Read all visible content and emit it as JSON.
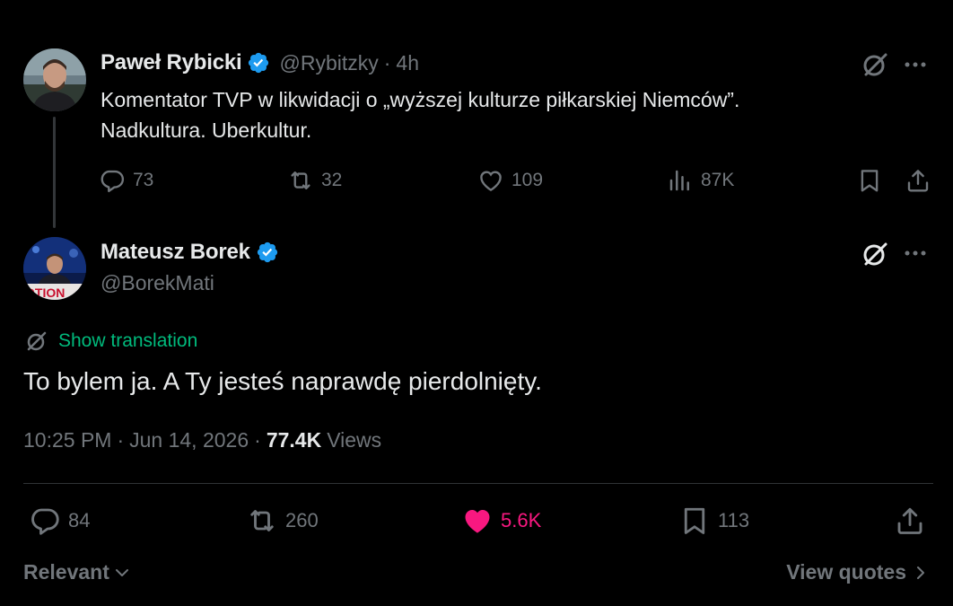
{
  "parent_tweet": {
    "display_name": "Paweł Rybicki",
    "handle": "@Rybitzky",
    "separator": "·",
    "time": "4h",
    "text_line1": "Komentator TVP w likwidacji o „wyższej kulturze piłkarskiej Niemców”.",
    "text_line2": "Nadkultura. Uberkultur.",
    "stats": {
      "replies": "73",
      "reposts": "32",
      "likes": "109",
      "views": "87K"
    }
  },
  "reply_tweet": {
    "display_name": "Mateusz Borek",
    "handle": "@BorekMati",
    "show_translation": "Show translation",
    "text": "To bylem ja. A Ty jesteś naprawdę pierdolnięty.",
    "timestamp": "10:25 PM",
    "date": "Jun 14, 2026",
    "separator": "·",
    "views_count": "77.4K",
    "views_label": "Views",
    "stats": {
      "replies": "84",
      "reposts": "260",
      "likes": "5.6K",
      "bookmarks": "113"
    }
  },
  "footer": {
    "sort_label": "Relevant",
    "view_quotes": "View quotes"
  },
  "colors": {
    "background": "#000000",
    "text_primary": "#e7e9ea",
    "text_secondary": "#71767b",
    "verified_blue": "#1d9bf0",
    "like_pink": "#f91880",
    "translation_green": "#00ba7c"
  }
}
